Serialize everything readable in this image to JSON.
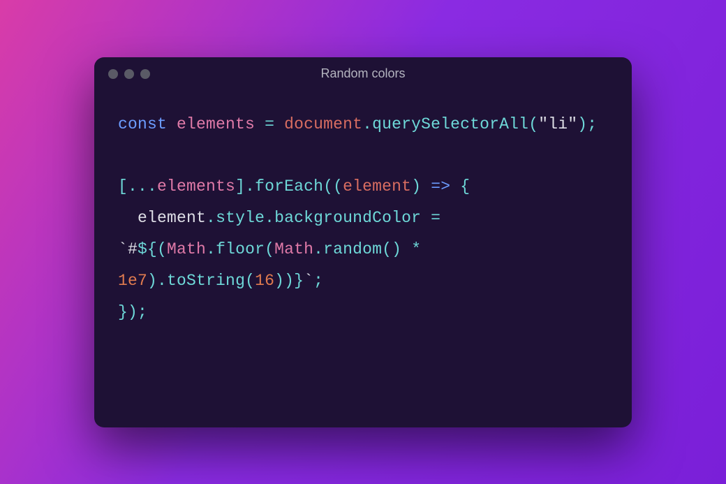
{
  "window": {
    "title": "Random colors"
  },
  "code": {
    "tokens": [
      {
        "t": "const ",
        "c": "tok-keyword"
      },
      {
        "t": "elements",
        "c": "tok-variable"
      },
      {
        "t": " ",
        "c": "tok-plain"
      },
      {
        "t": "=",
        "c": "tok-operator"
      },
      {
        "t": " ",
        "c": "tok-plain"
      },
      {
        "t": "document",
        "c": "tok-ident2"
      },
      {
        "t": ".",
        "c": "tok-punct"
      },
      {
        "t": "querySelectorAll",
        "c": "tok-property"
      },
      {
        "t": "(",
        "c": "tok-punct"
      },
      {
        "t": "\"li\"",
        "c": "tok-string"
      },
      {
        "t": ")",
        "c": "tok-punct"
      },
      {
        "t": ";",
        "c": "tok-punct"
      },
      {
        "t": "\n\n",
        "c": ""
      },
      {
        "t": "[",
        "c": "tok-punct"
      },
      {
        "t": "...",
        "c": "tok-operator"
      },
      {
        "t": "elements",
        "c": "tok-variable"
      },
      {
        "t": "]",
        "c": "tok-punct"
      },
      {
        "t": ".",
        "c": "tok-punct"
      },
      {
        "t": "forEach",
        "c": "tok-property"
      },
      {
        "t": "(",
        "c": "tok-punct"
      },
      {
        "t": "(",
        "c": "tok-punct"
      },
      {
        "t": "element",
        "c": "tok-ident2"
      },
      {
        "t": ")",
        "c": "tok-punct"
      },
      {
        "t": " ",
        "c": "tok-plain"
      },
      {
        "t": "=>",
        "c": "tok-arrow"
      },
      {
        "t": " ",
        "c": "tok-plain"
      },
      {
        "t": "{",
        "c": "tok-punct"
      },
      {
        "t": "\n  ",
        "c": ""
      },
      {
        "t": "element",
        "c": "tok-plain"
      },
      {
        "t": ".",
        "c": "tok-punct"
      },
      {
        "t": "style",
        "c": "tok-property"
      },
      {
        "t": ".",
        "c": "tok-punct"
      },
      {
        "t": "backgroundColor",
        "c": "tok-property"
      },
      {
        "t": " ",
        "c": "tok-plain"
      },
      {
        "t": "=",
        "c": "tok-operator"
      },
      {
        "t": " ",
        "c": "tok-plain"
      },
      {
        "t": "`#",
        "c": "tok-string"
      },
      {
        "t": "${",
        "c": "tok-operator"
      },
      {
        "t": "(",
        "c": "tok-punct"
      },
      {
        "t": "Math",
        "c": "tok-obj"
      },
      {
        "t": ".",
        "c": "tok-punct"
      },
      {
        "t": "floor",
        "c": "tok-property"
      },
      {
        "t": "(",
        "c": "tok-punct"
      },
      {
        "t": "Math",
        "c": "tok-obj"
      },
      {
        "t": ".",
        "c": "tok-punct"
      },
      {
        "t": "random",
        "c": "tok-property"
      },
      {
        "t": "(",
        "c": "tok-punct"
      },
      {
        "t": ")",
        "c": "tok-punct"
      },
      {
        "t": " ",
        "c": "tok-plain"
      },
      {
        "t": "*",
        "c": "tok-operator"
      },
      {
        "t": " ",
        "c": "tok-plain"
      },
      {
        "t": "1e7",
        "c": "tok-number"
      },
      {
        "t": ")",
        "c": "tok-punct"
      },
      {
        "t": ".",
        "c": "tok-punct"
      },
      {
        "t": "toString",
        "c": "tok-property"
      },
      {
        "t": "(",
        "c": "tok-punct"
      },
      {
        "t": "16",
        "c": "tok-number"
      },
      {
        "t": ")",
        "c": "tok-punct"
      },
      {
        "t": ")",
        "c": "tok-punct"
      },
      {
        "t": "}",
        "c": "tok-operator"
      },
      {
        "t": "`",
        "c": "tok-string"
      },
      {
        "t": ";",
        "c": "tok-punct"
      },
      {
        "t": "\n",
        "c": ""
      },
      {
        "t": "}",
        "c": "tok-punct"
      },
      {
        "t": ")",
        "c": "tok-punct"
      },
      {
        "t": ";",
        "c": "tok-punct"
      }
    ]
  }
}
